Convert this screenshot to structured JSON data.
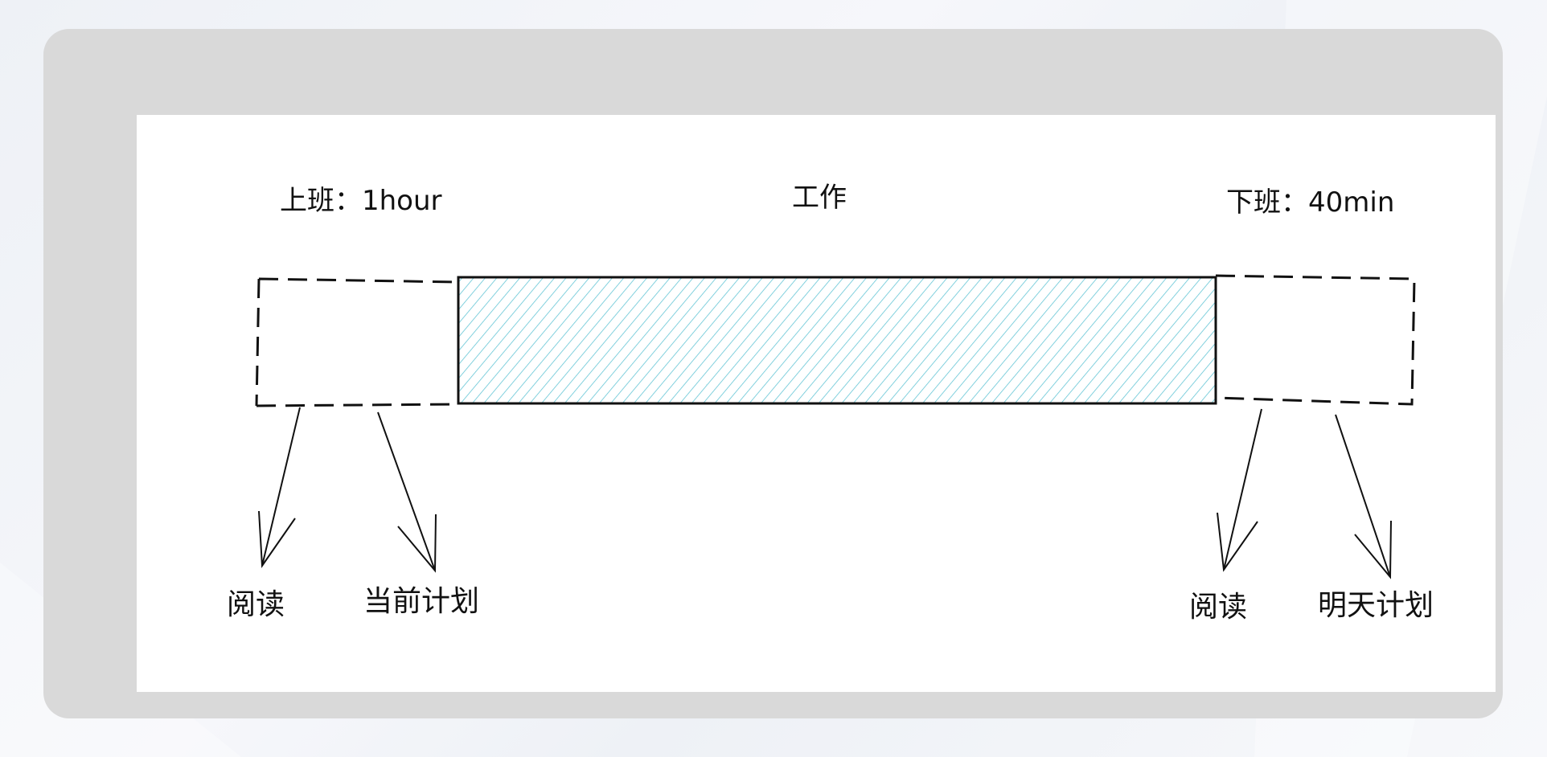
{
  "diagram": {
    "top_labels": {
      "commute_in": "上班：1hour",
      "work": "工作",
      "commute_out": "下班：40min"
    },
    "bottom_labels": {
      "left_read": "阅读",
      "current_plan": "当前计划",
      "right_read": "阅读",
      "tomorrow_plan": "明天计划"
    },
    "colors": {
      "frame": "#d9d9d9",
      "canvas": "#ffffff",
      "hatch": "#5bc2d3",
      "stroke": "#111111"
    }
  }
}
